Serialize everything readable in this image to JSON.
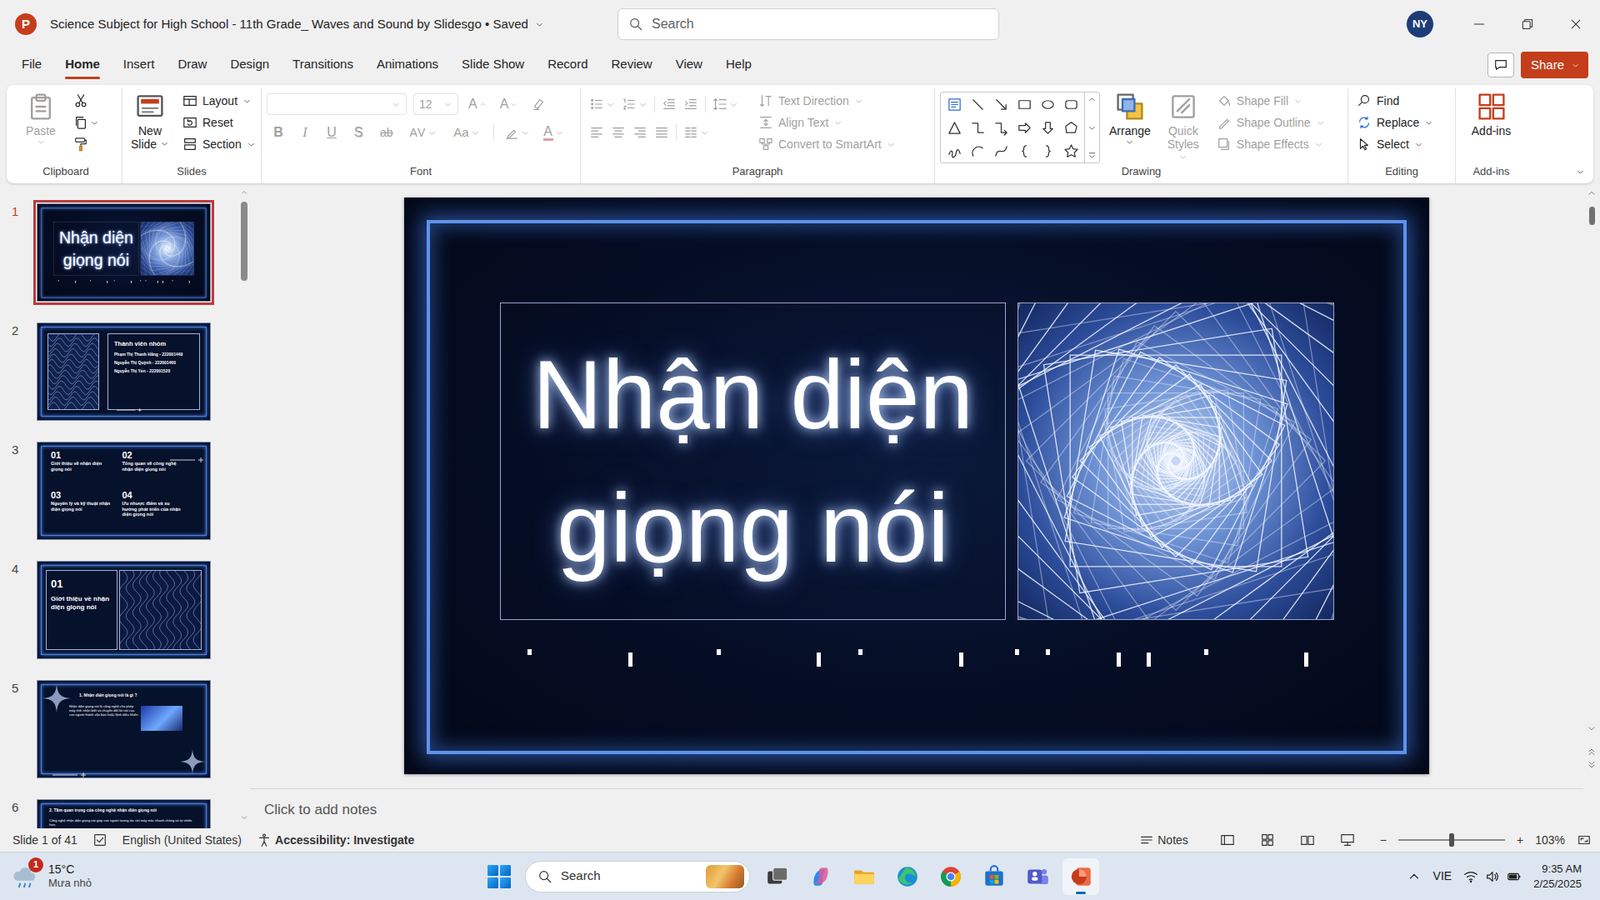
{
  "window": {
    "app_logo": "P",
    "title": "Science Subject for High School - 11th Grade_ Waves and Sound by Slidesgo • Saved",
    "search_placeholder": "Search",
    "avatar": "NY"
  },
  "menu": {
    "tabs": [
      {
        "label": "File",
        "selected": false
      },
      {
        "label": "Home",
        "selected": true
      },
      {
        "label": "Insert",
        "selected": false
      },
      {
        "label": "Draw",
        "selected": false
      },
      {
        "label": "Design",
        "selected": false
      },
      {
        "label": "Transitions",
        "selected": false
      },
      {
        "label": "Animations",
        "selected": false
      },
      {
        "label": "Slide Show",
        "selected": false
      },
      {
        "label": "Record",
        "selected": false
      },
      {
        "label": "Review",
        "selected": false
      },
      {
        "label": "View",
        "selected": false
      },
      {
        "label": "Help",
        "selected": false
      }
    ],
    "share": "Share"
  },
  "ribbon": {
    "clipboard": {
      "label": "Clipboard",
      "paste": "Paste",
      "paste_disabled": true
    },
    "slides": {
      "label": "Slides",
      "new_slide": "New Slide",
      "layout": "Layout",
      "reset": "Reset",
      "section": "Section"
    },
    "font": {
      "label": "Font",
      "disabled": true,
      "size": "12",
      "grow": "A",
      "shrink": "A",
      "buttons": [
        {
          "label": "B",
          "kind": "bold"
        },
        {
          "label": "I",
          "kind": "italic"
        },
        {
          "label": "U",
          "kind": "underline"
        },
        {
          "label": "S",
          "kind": "shadow"
        },
        {
          "label": "ab",
          "kind": "strike"
        },
        {
          "label": "AV",
          "kind": "spacing"
        },
        {
          "label": "Aa",
          "kind": "case"
        },
        {
          "label": "A",
          "kind": "color"
        }
      ]
    },
    "paragraph": {
      "label": "Paragraph",
      "disabled": true,
      "text_direction": "Text Direction",
      "align_text": "Align Text",
      "smartart": "Convert to SmartArt"
    },
    "drawing": {
      "label": "Drawing",
      "arrange": "Arrange",
      "quick_styles": "Quick Styles",
      "format_disabled": true,
      "shape_fill": "Shape Fill",
      "shape_outline": "Shape Outline",
      "shape_effects": "Shape Effects"
    },
    "editing": {
      "label": "Editing",
      "find": "Find",
      "replace": "Replace",
      "select": "Select"
    },
    "addins": {
      "label": "Add-ins",
      "button": "Add-ins"
    }
  },
  "thumbnails": [
    {
      "number": "1",
      "selected": true,
      "kind": "title",
      "title": "Nhận diện giọng nói"
    },
    {
      "number": "2",
      "selected": false,
      "kind": "members",
      "heading": "Thành viên nhóm",
      "members": [
        "Phạm Thị Thanh Hằng - 222001449",
        "Nguyễn Thị Quỳnh - 222001460",
        "Nguyễn Thị Yến - 222001520"
      ]
    },
    {
      "number": "3",
      "selected": false,
      "kind": "agenda",
      "items": [
        {
          "num": "01",
          "text": "Giới thiệu về nhận diện giọng nói"
        },
        {
          "num": "02",
          "text": "Tổng quan về công nghệ nhận diện giọng nói"
        },
        {
          "num": "03",
          "text": "Nguyên lý và kỹ thuật nhận diện giọng nói"
        },
        {
          "num": "04",
          "text": "Ưu nhược điểm và xu hướng phát triển của nhận diện giọng nói"
        }
      ]
    },
    {
      "number": "4",
      "selected": false,
      "kind": "section",
      "num": "01",
      "title": "Giới thiệu về nhận diện giọng nói"
    },
    {
      "number": "5",
      "selected": false,
      "kind": "content",
      "heading": "1. Nhận diện giọng nói là gì ?",
      "body": "Nhận diện giọng nói là công nghệ cho phép máy tính nhận biết và chuyển đổi lời nói của con người thành văn bản hoặc lệnh điều khiển."
    },
    {
      "number": "6",
      "selected": false,
      "kind": "text",
      "heading": "2. Tầm quan trọng của công nghệ nhận diện giọng nói",
      "body": "Công nghệ nhận diện giọng nói giúp con người tương tác với máy móc nhanh chóng và tự nhiên hơn."
    }
  ],
  "slide": {
    "title": "Nhận diện giọng nói"
  },
  "notes": {
    "placeholder": "Click to add notes"
  },
  "status_bar": {
    "slide": "Slide 1 of 41",
    "language": "English (United States)",
    "accessibility": "Accessibility: Investigate",
    "notes": "Notes",
    "zoom_out": "−",
    "zoom_in": "+",
    "zoom_slider": {
      "level": 0.5
    },
    "zoom": "103%"
  },
  "taskbar": {
    "weather": {
      "badge": "1",
      "temperature": "15°C",
      "condition": "Mưa nhỏ"
    },
    "search": "Search",
    "apps": [
      {
        "kind": "taskview",
        "running": false
      },
      {
        "kind": "copilot",
        "running": false
      },
      {
        "kind": "explorer",
        "running": false
      },
      {
        "kind": "edge",
        "running": false
      },
      {
        "kind": "chrome",
        "running": false
      },
      {
        "kind": "store",
        "running": false
      },
      {
        "kind": "teams",
        "running": false
      },
      {
        "kind": "powerpoint",
        "running": true
      }
    ],
    "language": "VIE",
    "time": "9:35 AM",
    "date": "2/25/2025"
  }
}
